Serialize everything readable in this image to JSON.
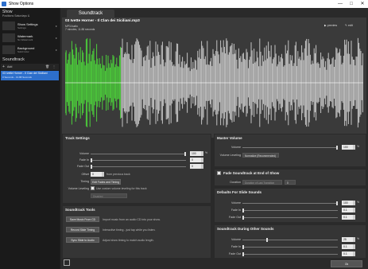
{
  "window": {
    "title": "Show Options"
  },
  "sidebar": {
    "show_heading": "Show",
    "show_sub": "Positions Saturdays &",
    "items": [
      {
        "thumb": "",
        "title": "Show Settings",
        "sub": "Settings"
      },
      {
        "thumb": "",
        "title": "Watermark",
        "sub": "No Watermark"
      },
      {
        "thumb": "",
        "title": "Background",
        "sub": "Solid Color"
      }
    ],
    "soundtrack_heading": "Soundtrack",
    "add_label": "Add",
    "tracks": [
      {
        "title": "03 Ivette Horner - Il Clan dei Siciliani",
        "sub": "0 Seconds - 13.88 Seconds"
      }
    ]
  },
  "main": {
    "tab_label": "Soundtrack",
    "file": {
      "name": "03 Ivette Horner - Il Clan dei Siciliani.mp3",
      "type": "MP3 Audio",
      "duration": "7 minutes, 11.88 seconds",
      "preview_label": "preview",
      "edit_label": "edit"
    },
    "track_settings": {
      "heading": "Track Settings",
      "volume_label": "Volume",
      "volume_value": "100",
      "volume_level": 1.0,
      "fade_in_label": "Fade In",
      "fade_in_value": "0",
      "fade_out_label": "Fade Out",
      "fade_out_value": "0",
      "offset_label": "Offset",
      "offset_value": "0",
      "offset_suffix": "from previous track",
      "timing_label": "Timing",
      "timing_value": "Edit Fades and Timing",
      "volume_leveling_label": "Volume Leveling",
      "volume_leveling_cb": "Use custom volume leveling for this track",
      "volume_leveling_select": "Disabled"
    },
    "soundtrack_tools": {
      "heading": "Soundtrack Tools",
      "tools": [
        {
          "button": "Save Music From CD",
          "desc": "Import music from an audio CD into your show."
        },
        {
          "button": "Record Slide Timing",
          "desc": "Interactive timing - just tap while you listen."
        },
        {
          "button": "Sync Slide to Audio",
          "desc": "Adjust show timing to match audio length."
        }
      ]
    },
    "master_volume": {
      "heading": "Master Volume",
      "volume_label": "Volume",
      "volume_value": "100",
      "volume_level": 1.0,
      "leveling_label": "Volume Leveling",
      "leveling_value": "Normalize (Recommended)"
    },
    "fade_end": {
      "heading": "Fade Soundtrack at End of Show",
      "duration_label": "Duration",
      "duration_select": "Duration of Last Transition",
      "duration_value": "0"
    },
    "defaults": {
      "heading": "Defaults For Slide Sounds",
      "volume_label": "Volume",
      "volume_value": "100",
      "fade_in_label": "Fade In",
      "fade_in_value": "0.1",
      "fade_out_label": "Fade Out",
      "fade_out_value": "0.1"
    },
    "during_other": {
      "heading": "Soundtrack During Other Sounds",
      "volume_label": "Volume",
      "volume_value": "25",
      "fade_in_label": "Fade In",
      "fade_in_value": "0.1",
      "fade_out_label": "Fade Out",
      "fade_out_value": "0.1"
    },
    "ok_label": "Ok"
  },
  "colors": {
    "accent": "#2d6fcc",
    "wave_played": "#4ccf3a",
    "wave_unplayed": "#c4c4c4"
  }
}
